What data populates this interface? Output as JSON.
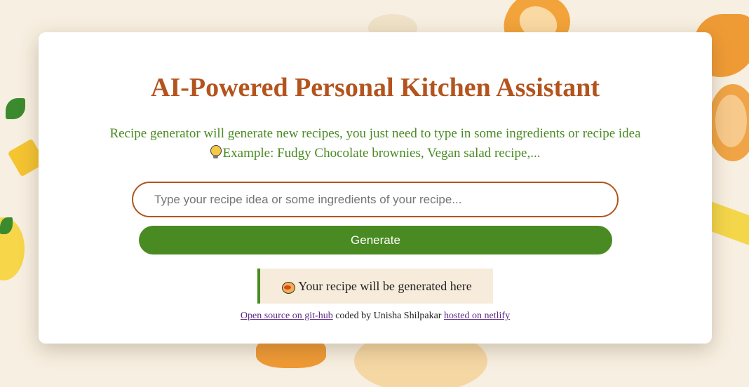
{
  "app": {
    "title": "AI-Powered Personal Kitchen Assistant",
    "subtitle_line1": "Recipe generator will generate new recipes, you just need to type in some ingredients or recipe idea",
    "subtitle_line2": "Example: Fudgy Chocolate brownies, Vegan salad recipe,..."
  },
  "search": {
    "placeholder": "Type your recipe idea or some ingredients of your recipe...",
    "value": ""
  },
  "generate_button": {
    "label": "Generate"
  },
  "result": {
    "text": "Your recipe will be generated here"
  },
  "footer": {
    "source_link": "Open source on git-hub",
    "coded_by": "coded by Unisha Shilpakar",
    "hosted_link": "hosted on netlify"
  },
  "icons": {
    "bulb": "lightbulb-icon",
    "result": "cooking-pot-icon"
  },
  "colors": {
    "title": "#b3541e",
    "accent_green": "#4a8a22",
    "background": "#f7efe1",
    "result_bg": "#f7ecdc",
    "link": "#5b2a86"
  }
}
